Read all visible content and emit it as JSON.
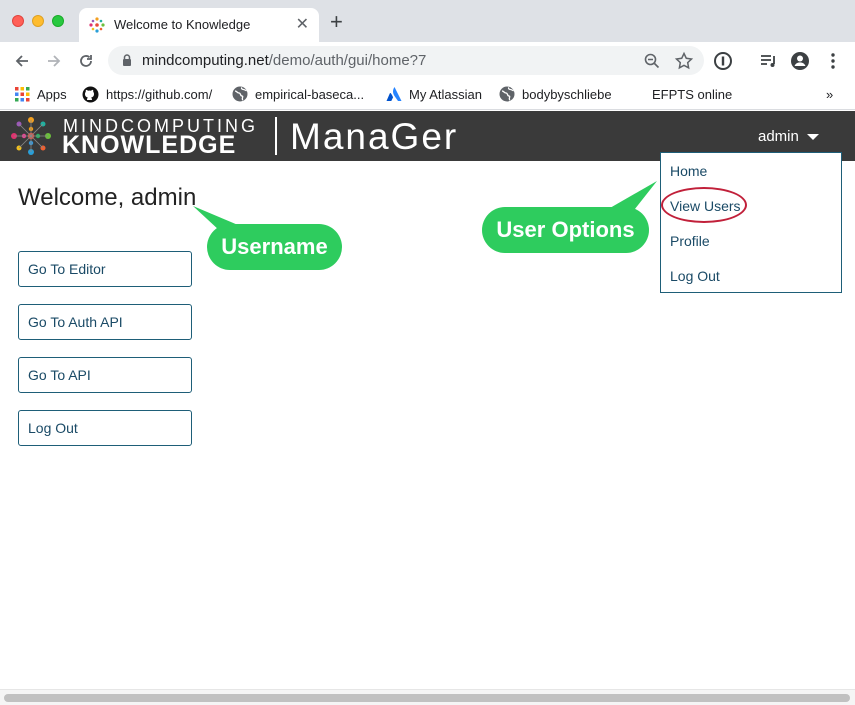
{
  "browser": {
    "tab_title": "Welcome to Knowledge",
    "url_domain": "mindcomputing.net",
    "url_path": "/demo/auth/gui/home?7",
    "bookmarks": [
      {
        "label": "Apps",
        "icon": "apps-grid-icon"
      },
      {
        "label": "https://github.com/",
        "icon": "github-icon"
      },
      {
        "label": "empirical-baseca...",
        "icon": "globe-icon"
      },
      {
        "label": "My Atlassian",
        "icon": "atlassian-icon"
      },
      {
        "label": "bodybyschliebe",
        "icon": "globe-icon"
      },
      {
        "label": "EFPTS online",
        "icon": ""
      }
    ],
    "overflow": "»"
  },
  "app": {
    "brand_top": "MINDCOMPUTING",
    "brand_bottom": "KNOWLEDGE",
    "product": "ManaGer",
    "user": "admin"
  },
  "dropdown": {
    "items": [
      "Home",
      "View Users",
      "Profile",
      "Log Out"
    ]
  },
  "main": {
    "welcome": "Welcome, admin",
    "buttons": [
      "Go To Editor",
      "Go To Auth API",
      "Go To API",
      "Log Out"
    ]
  },
  "annotations": {
    "username": "Username",
    "user_options": "User Options"
  },
  "colors": {
    "appbar": "#3a3a3a",
    "link": "#1a4a66",
    "border": "#1e5e78",
    "callout": "#2ecc5e",
    "highlight": "#c1203a"
  }
}
